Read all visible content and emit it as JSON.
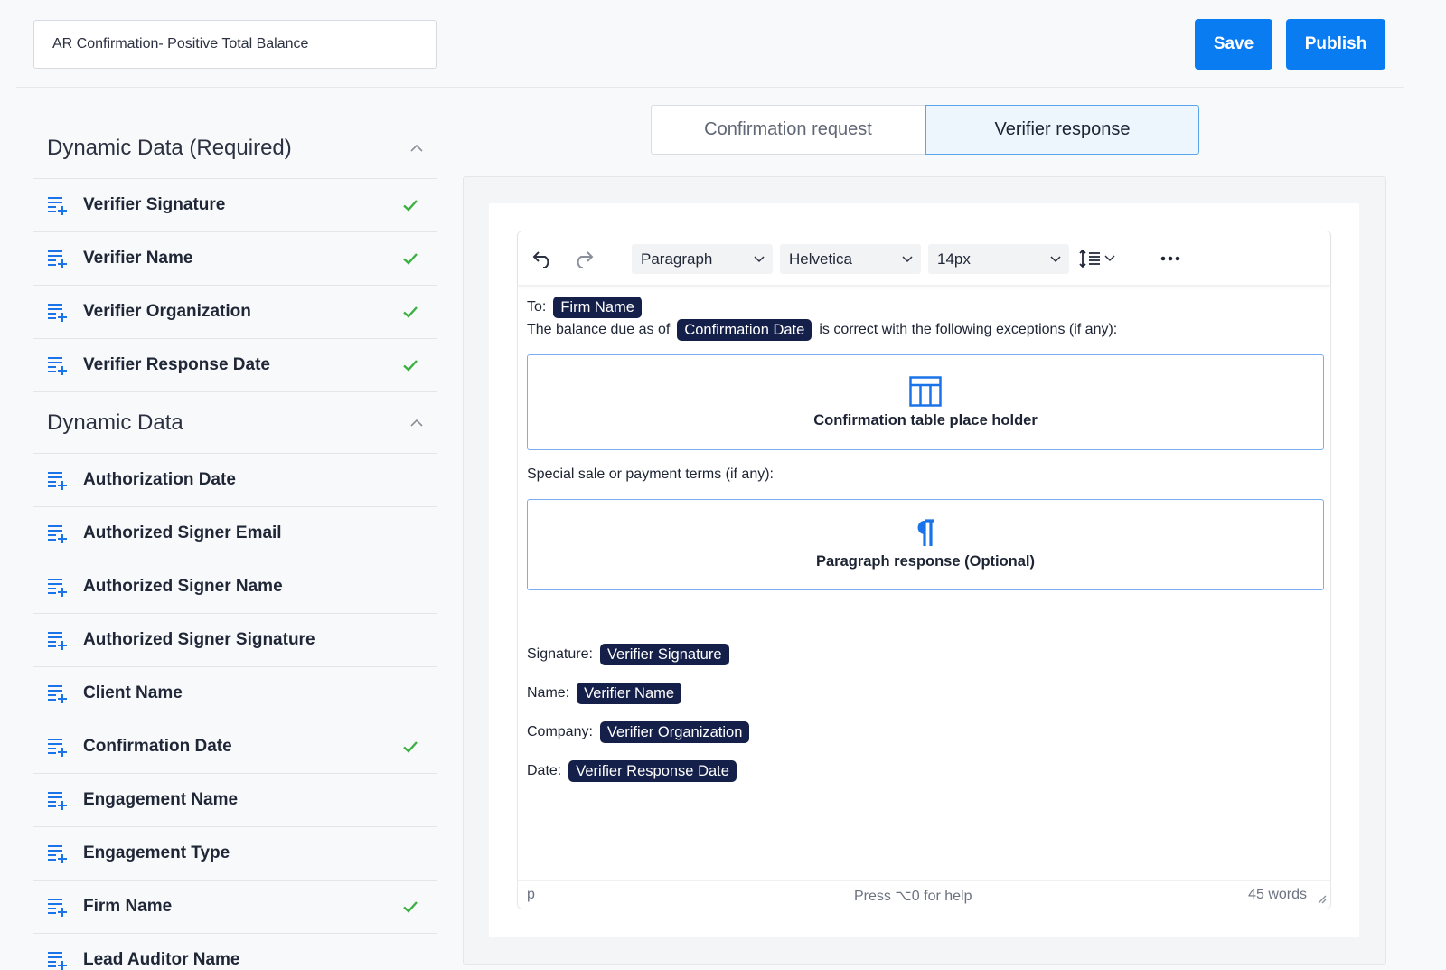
{
  "header": {
    "template_title": "AR Confirmation- Positive Total Balance",
    "save_label": "Save",
    "publish_label": "Publish"
  },
  "colors": {
    "accent": "#0a7cf2",
    "tag_bg": "#15204a",
    "check": "#3cb043"
  },
  "sidebar": {
    "required": {
      "title": "Dynamic Data (Required)",
      "items": [
        {
          "label": "Verifier Signature",
          "checked": true
        },
        {
          "label": "Verifier Name",
          "checked": true
        },
        {
          "label": "Verifier Organization",
          "checked": true
        },
        {
          "label": "Verifier Response Date",
          "checked": true
        }
      ]
    },
    "dynamic": {
      "title": "Dynamic Data",
      "items": [
        {
          "label": "Authorization Date",
          "checked": false
        },
        {
          "label": "Authorized Signer Email",
          "checked": false
        },
        {
          "label": "Authorized Signer Name",
          "checked": false
        },
        {
          "label": "Authorized Signer Signature",
          "checked": false
        },
        {
          "label": "Client Name",
          "checked": false
        },
        {
          "label": "Confirmation Date",
          "checked": true
        },
        {
          "label": "Engagement Name",
          "checked": false
        },
        {
          "label": "Engagement Type",
          "checked": false
        },
        {
          "label": "Firm Name",
          "checked": true
        },
        {
          "label": "Lead Auditor Name",
          "checked": false
        }
      ]
    }
  },
  "tabs": [
    {
      "label": "Confirmation request",
      "active": false
    },
    {
      "label": "Verifier response",
      "active": true
    }
  ],
  "toolbar": {
    "block_format": "Paragraph",
    "font_family": "Helvetica",
    "font_size": "14px",
    "icons": [
      "undo-icon",
      "redo-icon",
      "line-height-icon",
      "more-icon"
    ]
  },
  "document": {
    "to_label": "To:",
    "to_tag": "Firm Name",
    "balance_prefix": "The balance due as of",
    "balance_tag": "Confirmation Date",
    "balance_suffix": "is correct with the following exceptions (if any):",
    "table_placeholder": "Confirmation table place holder",
    "special_terms": "Special sale or payment terms (if any):",
    "paragraph_placeholder": "Paragraph response (Optional)",
    "signature_label": "Signature:",
    "signature_tag": "Verifier Signature",
    "name_label": "Name:",
    "name_tag": "Verifier Name",
    "company_label": "Company:",
    "company_tag": "Verifier Organization",
    "date_label": "Date:",
    "date_tag": "Verifier Response Date"
  },
  "statusbar": {
    "element_path": "p",
    "help_text": "Press ⌥0 for help",
    "word_count": "45 words"
  }
}
